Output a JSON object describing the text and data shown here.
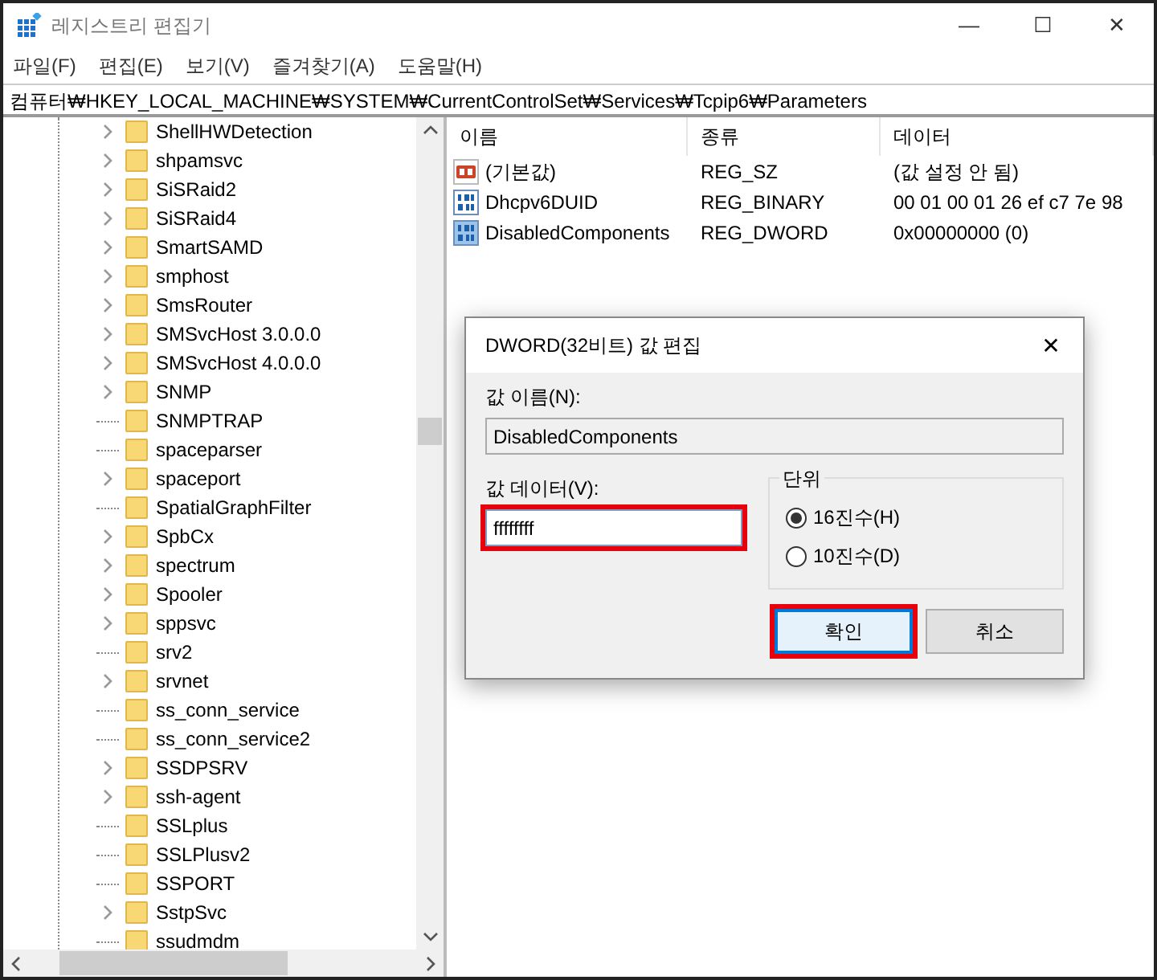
{
  "window": {
    "title": "레지스트리 편집기",
    "controls": [
      "—",
      "☐",
      "✕"
    ]
  },
  "menu": [
    "파일(F)",
    "편집(E)",
    "보기(V)",
    "즐겨찾기(A)",
    "도움말(H)"
  ],
  "address": "컴퓨터₩HKEY_LOCAL_MACHINE₩SYSTEM₩CurrentControlSet₩Services₩Tcpip6₩Parameters",
  "tree": [
    {
      "label": "ShellHWDetection",
      "has_children": true
    },
    {
      "label": "shpamsvc",
      "has_children": true
    },
    {
      "label": "SiSRaid2",
      "has_children": true
    },
    {
      "label": "SiSRaid4",
      "has_children": true
    },
    {
      "label": "SmartSAMD",
      "has_children": true
    },
    {
      "label": "smphost",
      "has_children": true
    },
    {
      "label": "SmsRouter",
      "has_children": true
    },
    {
      "label": "SMSvcHost 3.0.0.0",
      "has_children": true
    },
    {
      "label": "SMSvcHost 4.0.0.0",
      "has_children": true
    },
    {
      "label": "SNMP",
      "has_children": true
    },
    {
      "label": "SNMPTRAP",
      "has_children": false
    },
    {
      "label": "spaceparser",
      "has_children": false
    },
    {
      "label": "spaceport",
      "has_children": true
    },
    {
      "label": "SpatialGraphFilter",
      "has_children": false
    },
    {
      "label": "SpbCx",
      "has_children": true
    },
    {
      "label": "spectrum",
      "has_children": true
    },
    {
      "label": "Spooler",
      "has_children": true
    },
    {
      "label": "sppsvc",
      "has_children": true
    },
    {
      "label": "srv2",
      "has_children": false
    },
    {
      "label": "srvnet",
      "has_children": true
    },
    {
      "label": "ss_conn_service",
      "has_children": false
    },
    {
      "label": "ss_conn_service2",
      "has_children": false
    },
    {
      "label": "SSDPSRV",
      "has_children": true
    },
    {
      "label": "ssh-agent",
      "has_children": true
    },
    {
      "label": "SSLplus",
      "has_children": false
    },
    {
      "label": "SSLPlusv2",
      "has_children": false
    },
    {
      "label": "SSPORT",
      "has_children": false
    },
    {
      "label": "SstpSvc",
      "has_children": true
    },
    {
      "label": "ssudmdm",
      "has_children": false
    }
  ],
  "values": {
    "columns": [
      "이름",
      "종류",
      "데이터"
    ],
    "rows": [
      {
        "kind": "string",
        "name": "(기본값)",
        "type": "REG_SZ",
        "data": "(값 설정 안 됨)"
      },
      {
        "kind": "binary",
        "name": "Dhcpv6DUID",
        "type": "REG_BINARY",
        "data": "00 01 00 01 26 ef c7 7e 98"
      },
      {
        "kind": "binary",
        "name": "DisabledComponents",
        "type": "REG_DWORD",
        "data": "0x00000000 (0)"
      }
    ]
  },
  "dialog": {
    "title": "DWORD(32비트) 값 편집",
    "close": "✕",
    "name_label": "값 이름(N):",
    "name_value": "DisabledComponents",
    "data_label": "값 데이터(V):",
    "data_value": "ffffffff",
    "data_highlighted": true,
    "base_label": "단위",
    "bases": [
      {
        "label": "16진수(H)",
        "selected": true
      },
      {
        "label": "10진수(D)",
        "selected": false
      }
    ],
    "buttons": [
      {
        "label": "확인",
        "default": true,
        "highlighted": true
      },
      {
        "label": "취소",
        "default": false,
        "highlighted": false
      }
    ]
  }
}
